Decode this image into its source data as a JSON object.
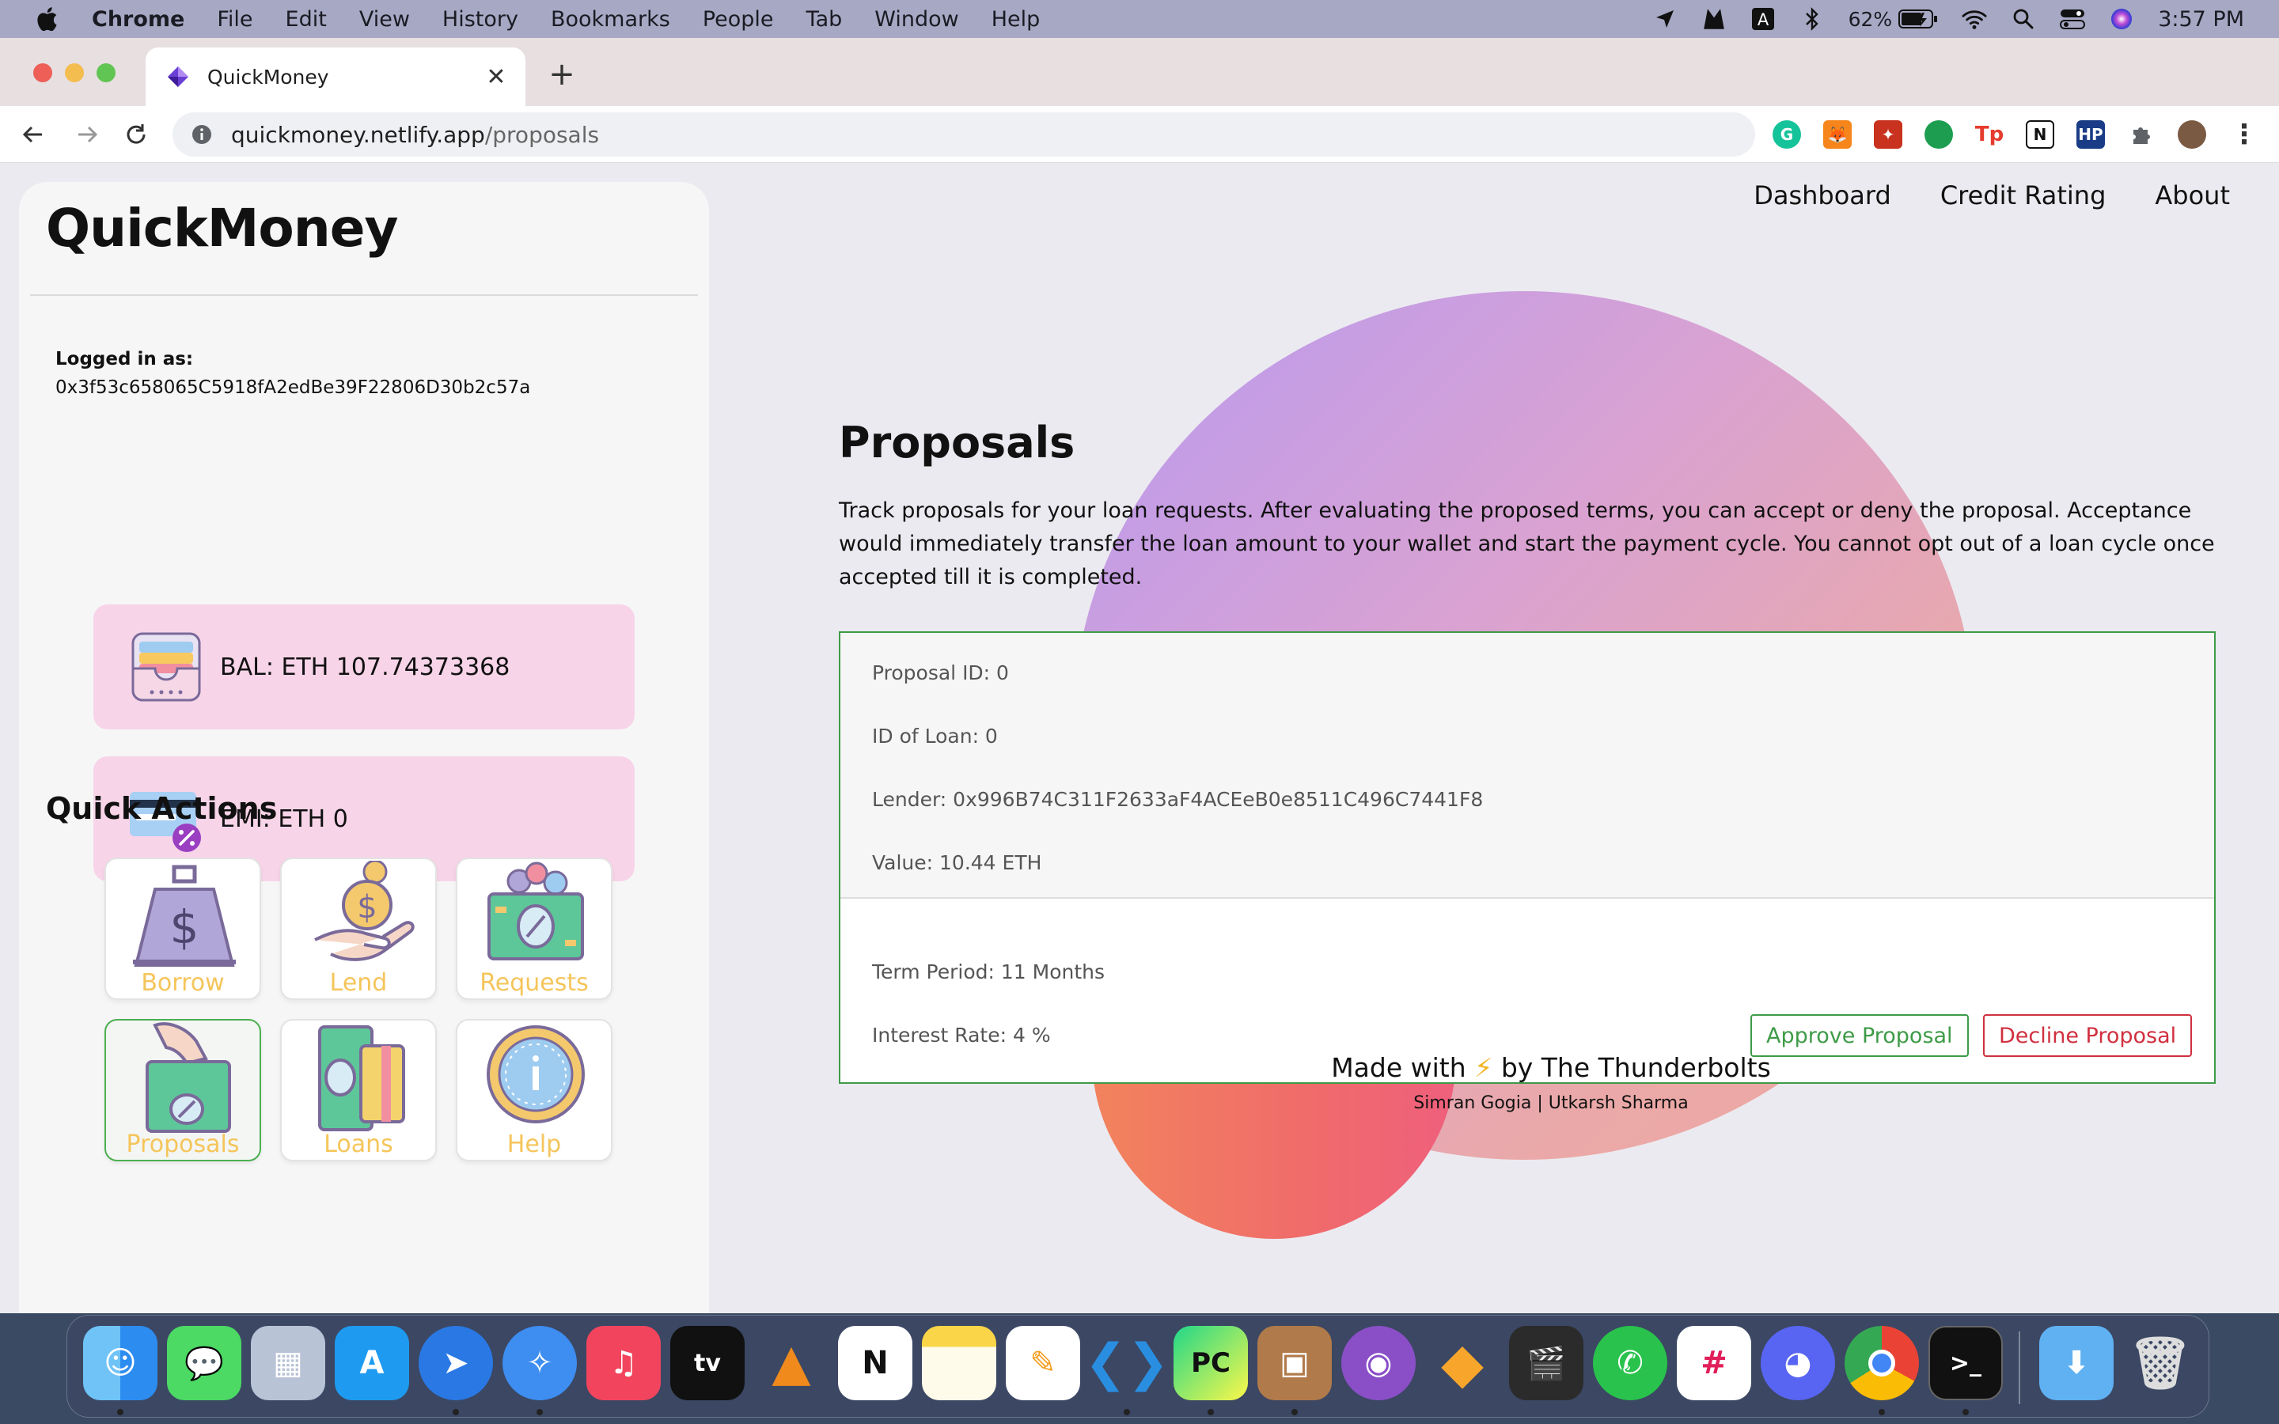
{
  "menubar": {
    "items": [
      "Chrome",
      "File",
      "Edit",
      "View",
      "History",
      "Bookmarks",
      "People",
      "Tab",
      "Window",
      "Help"
    ],
    "battery": "62%",
    "clock": "3:57 PM"
  },
  "browser": {
    "tab_title": "QuickMoney",
    "url_host": "quickmoney.netlify.app",
    "url_path": "/proposals"
  },
  "sidebar": {
    "brand": "QuickMoney",
    "logged_in_label": "Logged in as:",
    "address": "0x3f53c658065C5918fA2edBe39F22806D30b2c57a",
    "balance": "BAL: ETH 107.74373368",
    "emi": "EMI: ETH 0",
    "quick_actions_title": "Quick Actions",
    "actions": [
      {
        "label": "Borrow"
      },
      {
        "label": "Lend"
      },
      {
        "label": "Requests"
      },
      {
        "label": "Proposals"
      },
      {
        "label": "Loans"
      },
      {
        "label": "Help"
      }
    ]
  },
  "nav": {
    "dashboard": "Dashboard",
    "credit_rating": "Credit Rating",
    "about": "About"
  },
  "main": {
    "title": "Proposals",
    "description": "Track proposals for your loan requests. After evaluating the proposed terms, you can accept or deny the proposal. Acceptance would immediately transfer the loan amount to your wallet and start the payment cycle. You cannot opt out of a loan cycle once accepted till it is completed.",
    "proposal": {
      "id": "Proposal ID: 0",
      "loan_id": "ID of Loan: 0",
      "lender": "Lender: 0x996B74C311F2633aF4ACEeB0e8511C496C7441F8",
      "value": "Value: 10.44 ETH",
      "term": "Term Period: 11 Months",
      "interest": "Interest Rate: 4 %",
      "approve_label": "Approve Proposal",
      "decline_label": "Decline Proposal"
    }
  },
  "footer": {
    "made_prefix": "Made with",
    "bolt": "⚡",
    "made_suffix": "by The Thunderbolts",
    "names": "Simran Gogia | Utkarsh Sharma"
  },
  "colors": {
    "accent_green": "#3e9b47",
    "danger_red": "#d0303f",
    "card_pink": "#f7d4e8",
    "action_label": "#f5c55b"
  },
  "dock": {
    "apps": [
      "finder-icon",
      "messages-icon",
      "launchpad-icon",
      "app-store-icon",
      "spark-icon",
      "safari-icon",
      "music-icon",
      "apple-tv-icon",
      "vlc-icon",
      "notion-icon",
      "notes-icon",
      "pages-icon",
      "vscode-icon",
      "pycharm-icon",
      "package-icon",
      "github-desktop-icon",
      "sketch-icon",
      "final-cut-icon",
      "whatsapp-icon",
      "slack-icon",
      "discord-icon",
      "chrome-icon",
      "terminal-icon",
      "downloads-folder-icon",
      "trash-icon"
    ]
  }
}
